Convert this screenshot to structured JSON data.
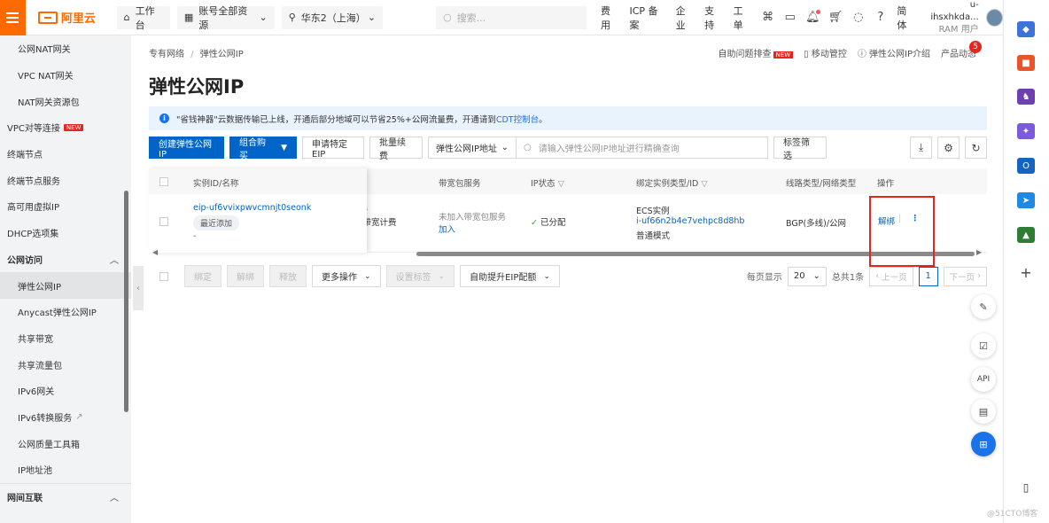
{
  "brand": {
    "name": "阿里云",
    "accent": "#ff6a00"
  },
  "topbar": {
    "workbench": "工作台",
    "resources": "账号全部资源",
    "region": "华东2（上海）",
    "search_placeholder": "搜索...",
    "links": [
      "费用",
      "ICP 备案",
      "企业",
      "支持",
      "工单"
    ],
    "lang": "简体",
    "user_name": "u-ihsxhkda...",
    "user_role": "RAM 用户"
  },
  "sidebar": {
    "items": [
      {
        "label": "公网NAT网关",
        "kind": "sub"
      },
      {
        "label": "VPC NAT网关",
        "kind": "sub"
      },
      {
        "label": "NAT网关资源包",
        "kind": "sub"
      },
      {
        "label": "VPC对等连接",
        "kind": "lvl0",
        "badge": "NEW"
      },
      {
        "label": "终端节点",
        "kind": "lvl0"
      },
      {
        "label": "终端节点服务",
        "kind": "lvl0"
      },
      {
        "label": "高可用虚拟IP",
        "kind": "lvl0"
      },
      {
        "label": "DHCP选项集",
        "kind": "lvl0"
      },
      {
        "label": "公网访问",
        "kind": "group"
      },
      {
        "label": "弹性公网IP",
        "kind": "sub",
        "active": true
      },
      {
        "label": "Anycast弹性公网IP",
        "kind": "sub"
      },
      {
        "label": "共享带宽",
        "kind": "sub"
      },
      {
        "label": "共享流量包",
        "kind": "sub"
      },
      {
        "label": "IPv6网关",
        "kind": "sub"
      },
      {
        "label": "IPv6转换服务",
        "kind": "sub"
      },
      {
        "label": "公网质量工具箱",
        "kind": "sub"
      },
      {
        "label": "IP地址池",
        "kind": "sub"
      },
      {
        "label": "网间互联",
        "kind": "group"
      }
    ]
  },
  "breadcrumb": {
    "parent": "专有网络",
    "sep": "/",
    "current": "弹性公网IP"
  },
  "header_links": {
    "diagnose": "自助问题排查",
    "diagnose_badge": "NEW",
    "mobile": "移动管控",
    "intro": "弹性公网IP介绍",
    "news": "产品动态",
    "news_count": "5"
  },
  "page_title": "弹性公网IP",
  "notice": {
    "text": "\"省钱神器\"云数据传输已上线，开通后部分地域可以节省25%+公网流量费，开通请到",
    "link": "CDT控制台",
    "end": "。"
  },
  "toolbar": {
    "create": "创建弹性公网IP",
    "combo": "组合购买",
    "apply": "申请特定EIP",
    "renew": "批量续费",
    "filter_select": "弹性公网IP地址",
    "search_placeholder": "请输入弹性公网IP地址进行精确查询",
    "tag_filter": "标签筛选"
  },
  "table": {
    "headers": {
      "id": "实例ID/名称",
      "bandwidth_pkg": "带宽包服务",
      "ip_status": "IP状态",
      "bind_type": "绑定实例类型/ID",
      "line_type": "线路类型/网络类型",
      "action": "操作"
    },
    "rows": [
      {
        "id": "eip-uf6vvixpwvcmnjt0seonk",
        "tag": "最近添加",
        "name": "-",
        "partial_1": "ps",
        "partial_2": "宽带宽计费",
        "pkg_text": "未加入带宽包服务",
        "pkg_link": "加入",
        "status": "已分配",
        "bind_type": "ECS实例",
        "bind_id": "i-uf66n2b4e7vehpc8d8hb",
        "bind_mode": "普通模式",
        "line": "BGP(多线)/公网",
        "action": "解绑"
      }
    ]
  },
  "bottom": {
    "bind": "绑定",
    "unbind": "解绑",
    "release": "释放",
    "more": "更多操作",
    "set_tags": "设置标签",
    "auto_quota": "自助提升EIP配额",
    "per_page_label": "每页显示",
    "per_page": "20",
    "total": "总共1条",
    "prev": "上一页",
    "page": "1",
    "next": "下一页"
  },
  "float": {
    "api": "API"
  },
  "watermark": "@51CTO博客"
}
